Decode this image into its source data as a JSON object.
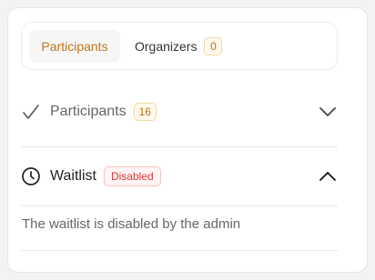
{
  "tabs": [
    {
      "label": "Participants",
      "active": true
    },
    {
      "label": "Organizers",
      "count": "0"
    }
  ],
  "sections": {
    "participants": {
      "title": "Participants",
      "count": "16",
      "icon": "check-icon",
      "expanded": false
    },
    "waitlist": {
      "title": "Waitlist",
      "status": "Disabled",
      "icon": "clock-icon",
      "expanded": true,
      "body": "The waitlist is disabled by the admin"
    }
  },
  "colors": {
    "accent": "#c2761c",
    "count_badge_bg": "#fff9ec",
    "disabled_badge_text": "#d33b3b",
    "disabled_badge_bg": "#fff3f3"
  }
}
